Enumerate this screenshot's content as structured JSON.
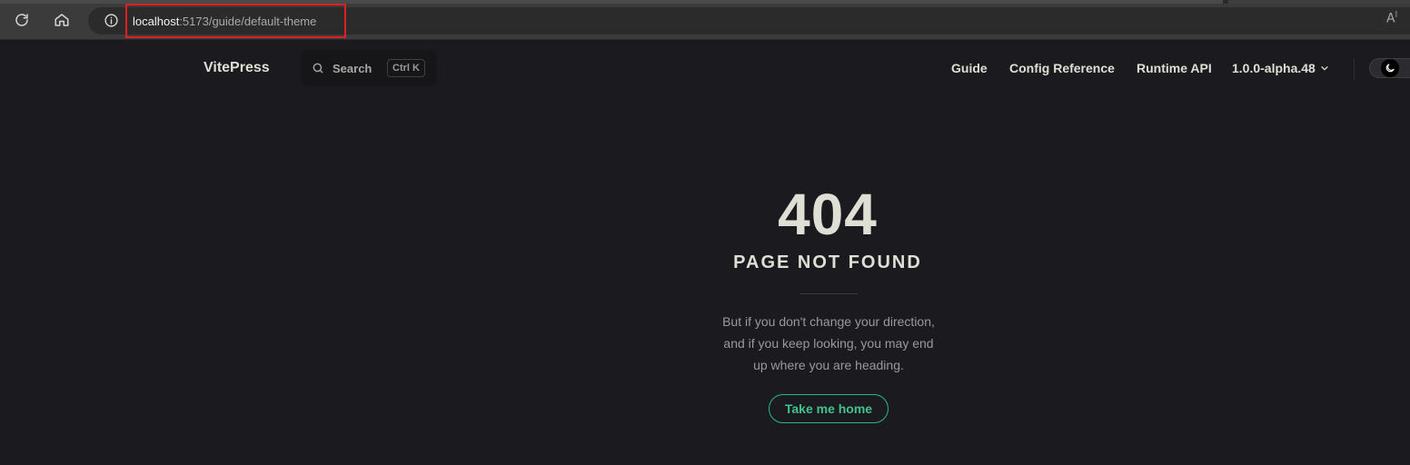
{
  "browser": {
    "url_host": "localhost",
    "url_rest": ":5173/guide/default-theme",
    "read_aloud_icon": "read-aloud-icon"
  },
  "nav": {
    "brand": "VitePress",
    "search": {
      "label": "Search",
      "shortcut": "Ctrl K"
    },
    "links": [
      "Guide",
      "Config Reference",
      "Runtime API"
    ],
    "version": "1.0.0-alpha.48"
  },
  "notfound": {
    "code": "404",
    "title": "PAGE NOT FOUND",
    "quote_lines": [
      "But if you don't change your direction,",
      "and if you keep looking, you may end",
      "up where you are heading."
    ],
    "home_label": "Take me home"
  },
  "colors": {
    "background": "#1b1b1f",
    "brand_green": "#42c28d",
    "highlight_red": "#e02020"
  }
}
